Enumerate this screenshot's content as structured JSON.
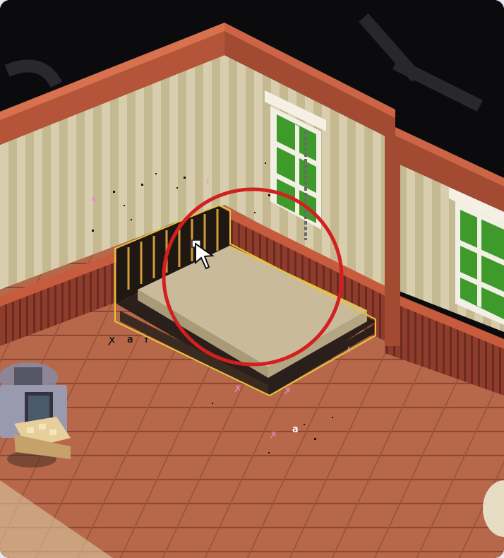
{
  "scene": {
    "room": "bedroom",
    "view": "isometric pixel-art room editor",
    "selected_object": "bed",
    "highlight_color": "#d31f1f",
    "selection_outline_color": "#e7c33a"
  },
  "icons": {
    "cursor": "pointer-arrow-icon",
    "move_handle": "move-handle-icon",
    "bed_controls": [
      "close-icon",
      "rotate-icon",
      "up-arrow-icon"
    ]
  },
  "labels": {
    "bed_controls": [
      "ꭗ",
      "a",
      "↑"
    ],
    "floor_glyph": "a"
  },
  "colors": {
    "wall_stripe_light": "#d8ceae",
    "wall_stripe_dark": "#c5b992",
    "wainscot": "#8e3d2c",
    "floor": "#b8684a",
    "trim": "#c65b3d",
    "mattress": "#c9bb99",
    "window_glass": "#3f9a2c"
  }
}
